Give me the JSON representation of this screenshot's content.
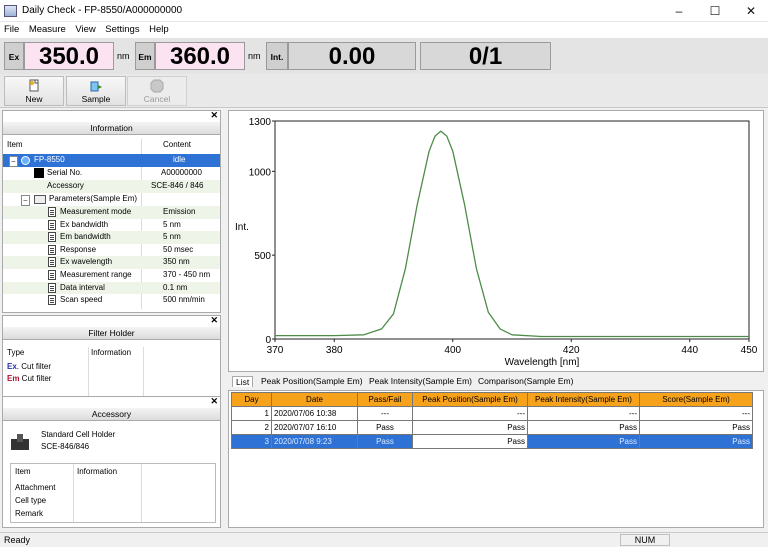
{
  "window": {
    "title": "Daily Check - FP-8550/A000000000",
    "min": "–",
    "max": "☐",
    "close": "✕"
  },
  "menu": [
    "File",
    "Measure",
    "View",
    "Settings",
    "Help"
  ],
  "readout": {
    "ex_label": "Ex",
    "ex_value": "350.0",
    "ex_unit": "nm",
    "em_label": "Em",
    "em_value": "360.0",
    "em_unit": "nm",
    "int_label": "Int.",
    "int_value": "0.00",
    "counter": "0/1"
  },
  "toolbar": {
    "new": "New",
    "sample": "Sample",
    "cancel": "Cancel"
  },
  "information": {
    "title": "Information",
    "col_item": "Item",
    "col_content": "Content",
    "instrument": "FP-8550",
    "instrument_state": "idle",
    "serial_label": "Serial No.",
    "serial_value": "A00000000",
    "accessory_label": "Accessory",
    "accessory_value": "SCE-846 / 846",
    "params_label": "Parameters(Sample Em)",
    "params": [
      {
        "name": "Measurement mode",
        "value": "Emission"
      },
      {
        "name": "Ex bandwidth",
        "value": "5 nm"
      },
      {
        "name": "Em bandwidth",
        "value": "5 nm"
      },
      {
        "name": "Response",
        "value": "50 msec"
      },
      {
        "name": "Ex wavelength",
        "value": "350 nm"
      },
      {
        "name": "Measurement range",
        "value": "370 - 450 nm"
      },
      {
        "name": "Data interval",
        "value": "0.1 nm"
      },
      {
        "name": "Scan speed",
        "value": "500 nm/min"
      }
    ]
  },
  "filter_holder": {
    "title": "Filter Holder",
    "col_type": "Type",
    "col_info": "Information",
    "ex_prefix": "Ex",
    "ex_rest": ". Cut filter",
    "em_prefix": "Em",
    "em_rest": " Cut filter"
  },
  "accessory": {
    "title": "Accessory",
    "name": "Standard Cell Holder",
    "model": "SCE-846/846",
    "col_item": "Item",
    "col_info": "Information",
    "rows": [
      "Attachment",
      "Cell type",
      "Remark"
    ]
  },
  "chart_data": {
    "type": "line",
    "xlabel": "Wavelength [nm]",
    "ylabel": "Int.",
    "xlim": [
      370,
      450
    ],
    "ylim": [
      0,
      1300
    ],
    "xticks": [
      370,
      380,
      400,
      420,
      440,
      450
    ],
    "yticks": [
      0,
      500,
      1000,
      1300
    ],
    "series": [
      {
        "color": "#4e8c4a",
        "x": [
          370,
          380,
          385,
          388,
          390,
          392,
          394,
          396,
          397,
          398,
          399,
          400,
          402,
          404,
          406,
          408,
          410,
          415,
          420,
          430,
          440,
          450
        ],
        "y": [
          20,
          20,
          25,
          60,
          150,
          420,
          800,
          1120,
          1210,
          1240,
          1210,
          1120,
          800,
          420,
          160,
          60,
          25,
          15,
          15,
          15,
          15,
          15
        ]
      }
    ]
  },
  "tabs": [
    "List",
    "Peak Position(Sample Em)",
    "Peak Intensity(Sample Em)",
    "Comparison(Sample Em)"
  ],
  "results": {
    "headers": [
      "Day",
      "Date",
      "Pass/Fail",
      "Peak Position(Sample Em)",
      "Peak Intensity(Sample Em)",
      "Score(Sample Em)"
    ],
    "rows": [
      [
        "1",
        "2020/07/06 10:38",
        "---",
        "---",
        "---",
        "---"
      ],
      [
        "2",
        "2020/07/07 16:10",
        "Pass",
        "Pass",
        "Pass",
        "Pass"
      ],
      [
        "3",
        "2020/07/08 9:23",
        "Pass",
        "Pass",
        "Pass",
        "Pass"
      ]
    ]
  },
  "status": {
    "left": "Ready",
    "num": "NUM"
  }
}
